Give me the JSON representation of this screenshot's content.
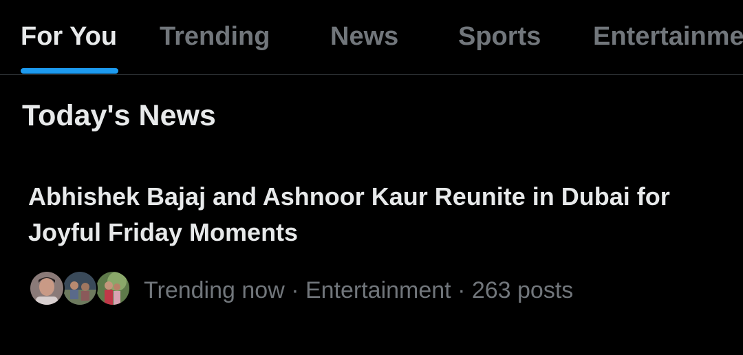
{
  "tabs": [
    {
      "label": "For You",
      "active": true
    },
    {
      "label": "Trending",
      "active": false
    },
    {
      "label": "News",
      "active": false
    },
    {
      "label": "Sports",
      "active": false
    },
    {
      "label": "Entertainment",
      "active": false
    }
  ],
  "colors": {
    "background": "#000000",
    "primary_text": "#e7e9ea",
    "secondary_text": "#71767b",
    "accent": "#1d9bf0",
    "divider": "#2f3336"
  },
  "section": {
    "title": "Today's News"
  },
  "news": {
    "headline": "Abhishek Bajaj and Ashnoor Kaur Reunite in Dubai for Joyful Friday Moments",
    "meta": "Trending now · Entertainment · 263 posts",
    "avatars": [
      "avatar-photo-man",
      "avatar-photo-group",
      "avatar-photo-couple"
    ]
  }
}
